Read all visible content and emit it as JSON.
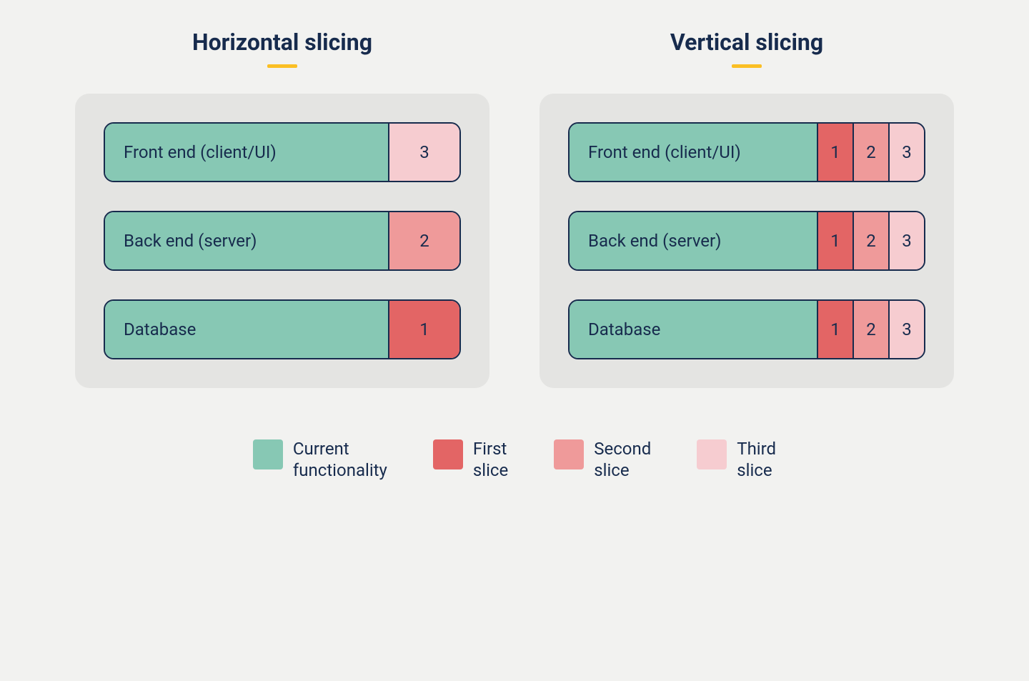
{
  "colors": {
    "current": "#87c8b4",
    "first": "#e36565",
    "second": "#ef9a9a",
    "third": "#f6ccd0",
    "text": "#172B4D",
    "accent": "#fbbf24"
  },
  "chart_data": [
    {
      "type": "bar",
      "title": "Horizontal slicing",
      "layers": [
        {
          "name": "Front end (client/UI)",
          "current": true,
          "slices": [
            3
          ]
        },
        {
          "name": "Back end (server)",
          "current": true,
          "slices": [
            2
          ]
        },
        {
          "name": "Database",
          "current": true,
          "slices": [
            1
          ]
        }
      ]
    },
    {
      "type": "bar",
      "title": "Vertical slicing",
      "layers": [
        {
          "name": "Front end (client/UI)",
          "current": true,
          "slices": [
            1,
            2,
            3
          ]
        },
        {
          "name": "Back end (server)",
          "current": true,
          "slices": [
            1,
            2,
            3
          ]
        },
        {
          "name": "Database",
          "current": true,
          "slices": [
            1,
            2,
            3
          ]
        }
      ]
    }
  ],
  "left": {
    "title": "Horizontal slicing",
    "rows": [
      {
        "label": "Front end (client/UI)",
        "tag": "3",
        "tagColor": "third"
      },
      {
        "label": "Back end (server)",
        "tag": "2",
        "tagColor": "second"
      },
      {
        "label": "Database",
        "tag": "1",
        "tagColor": "first"
      }
    ]
  },
  "right": {
    "title": "Vertical slicing",
    "rows": [
      {
        "label": "Front end (client/UI)"
      },
      {
        "label": "Back end (server)"
      },
      {
        "label": "Database"
      }
    ],
    "tags": [
      "1",
      "2",
      "3"
    ],
    "tagColors": [
      "first",
      "second",
      "third"
    ]
  },
  "legend": [
    {
      "color": "current",
      "line1": "Current",
      "line2": "functionality"
    },
    {
      "color": "first",
      "line1": "First",
      "line2": "slice"
    },
    {
      "color": "second",
      "line1": "Second",
      "line2": "slice"
    },
    {
      "color": "third",
      "line1": "Third",
      "line2": "slice"
    }
  ]
}
